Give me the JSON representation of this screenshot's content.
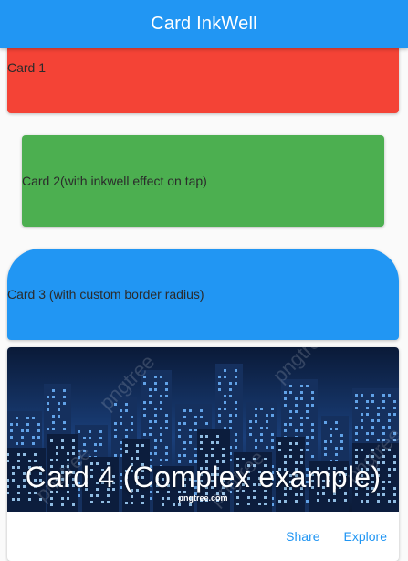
{
  "appbar": {
    "title": "Card InkWell"
  },
  "cards": [
    {
      "label": "Card 1",
      "color": "#f44336"
    },
    {
      "label": "Card 2(with inkwell effect on tap)",
      "color": "#4caf50"
    },
    {
      "label": "Card 3 (with custom border radius)",
      "color": "#2196f3"
    }
  ],
  "complex_card": {
    "title": "Card 4 (Complex example)",
    "image_watermark": "pngtree.com",
    "image_watermark_repeat": "pngtree",
    "actions": {
      "share_label": "Share",
      "explore_label": "Explore"
    }
  },
  "colors": {
    "primary": "#2196f3",
    "night_sky": "#0d1f3f"
  }
}
